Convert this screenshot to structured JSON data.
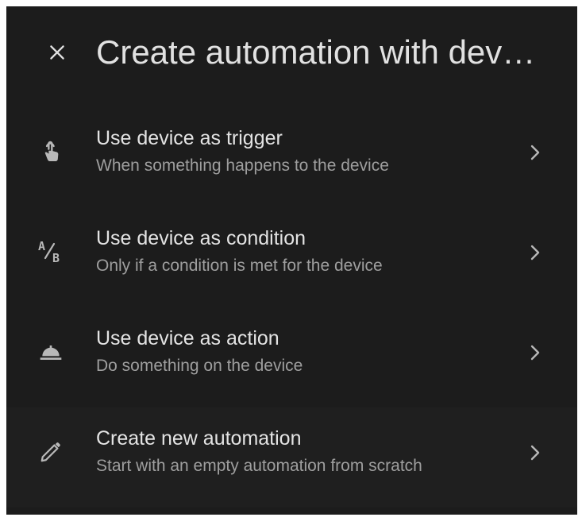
{
  "dialog": {
    "title": "Create automation with dev…",
    "close_icon": "close-icon"
  },
  "items": [
    {
      "icon": "gesture-tap-icon",
      "title": "Use device as trigger",
      "subtitle": "When something happens to the device",
      "chevron_icon": "chevron-right-icon"
    },
    {
      "icon": "a-slash-b-icon",
      "title": "Use device as condition",
      "subtitle": "Only if a condition is met for the device",
      "chevron_icon": "chevron-right-icon"
    },
    {
      "icon": "room-service-icon",
      "title": "Use device as action",
      "subtitle": "Do something on the device",
      "chevron_icon": "chevron-right-icon"
    },
    {
      "icon": "pencil-icon",
      "title": "Create new automation",
      "subtitle": "Start with an empty automation from scratch",
      "chevron_icon": "chevron-right-icon"
    }
  ],
  "colors": {
    "background": "#1c1c1c",
    "text_primary": "#e1e1e1",
    "text_secondary": "#9e9e9e",
    "icon": "#b8b8b8"
  }
}
